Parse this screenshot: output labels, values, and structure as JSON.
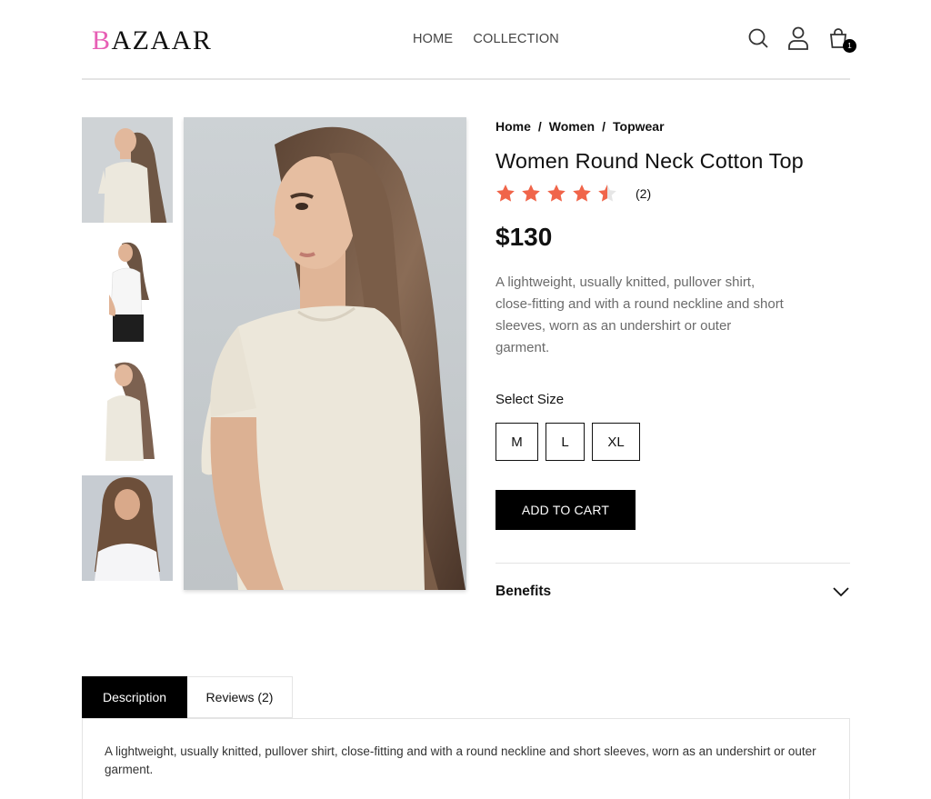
{
  "header": {
    "logo_first": "B",
    "logo_rest": "AZAAR",
    "nav": [
      {
        "label": "HOME"
      },
      {
        "label": "COLLECTION"
      }
    ],
    "cart_count": "1",
    "icons": [
      "search-icon",
      "user-icon",
      "cart-icon"
    ]
  },
  "gallery": {
    "thumbnails": [
      "side-view-cream-top",
      "profile-white-top",
      "side-view-cream-top-2",
      "front-view-white-top"
    ],
    "main": "model-cream-round-neck-top"
  },
  "product": {
    "breadcrumb": [
      {
        "label": "Home"
      },
      {
        "label": "Women"
      },
      {
        "label": "Topwear"
      }
    ],
    "breadcrumb_sep": "/",
    "title": "Women Round Neck Cotton Top",
    "rating": 4.5,
    "rating_count": "(2)",
    "price": "$130",
    "description": "A lightweight, usually knitted, pullover shirt, close-fitting and with a round neckline and short sleeves, worn as an undershirt or outer garment.",
    "size_label": "Select Size",
    "sizes": [
      {
        "label": "M"
      },
      {
        "label": "L"
      },
      {
        "label": "XL"
      }
    ],
    "add_to_cart": "ADD TO CART",
    "benefits_label": "Benefits"
  },
  "tabs": {
    "items": [
      {
        "label": "Description"
      },
      {
        "label": "Reviews (2)"
      }
    ],
    "active": 0,
    "panel_text": "A lightweight, usually knitted, pullover shirt, close-fitting and with a round neckline and short sleeves, worn as an undershirt or outer garment."
  },
  "colors": {
    "accent_logo": "#e75fb5",
    "star": "#f0654a",
    "primary": "#000000"
  }
}
